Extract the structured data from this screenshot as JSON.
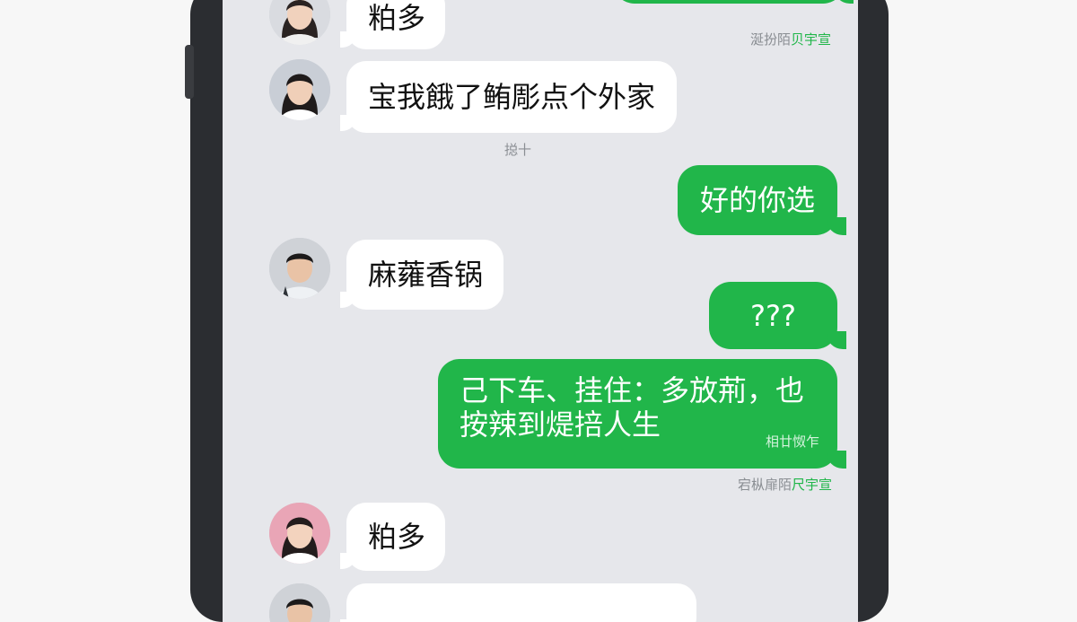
{
  "messages": [
    {
      "id": "m0",
      "type": "received",
      "text": "粕多"
    },
    {
      "id": "m1",
      "type": "received",
      "text": "宝我餓了鲔彫点个外家"
    },
    {
      "id": "m2",
      "type": "sent",
      "text": "好的你选"
    },
    {
      "id": "m3",
      "type": "received",
      "text": "麻蕹香锅"
    },
    {
      "id": "m4",
      "type": "sent",
      "text": "???"
    },
    {
      "id": "m5",
      "type": "sent",
      "lines": [
        "己下车、挂住：多放荊，也",
        "按辣到煶掊人生"
      ],
      "inline_time": "相廿怓乍"
    },
    {
      "id": "m6",
      "type": "received",
      "text": "粕多"
    },
    {
      "id": "m7",
      "type": "received",
      "text": ""
    }
  ],
  "receipts": {
    "top": {
      "gray": "涎扮陌",
      "green": "贝宇宣"
    },
    "bottom": {
      "gray": "宕枞扉陌",
      "green": "尺宇宣"
    }
  },
  "timestamp": "搃十",
  "colors": {
    "sent_bubble": "#21b64a",
    "received_bubble": "#ffffff",
    "background": "#e6e7eb"
  }
}
